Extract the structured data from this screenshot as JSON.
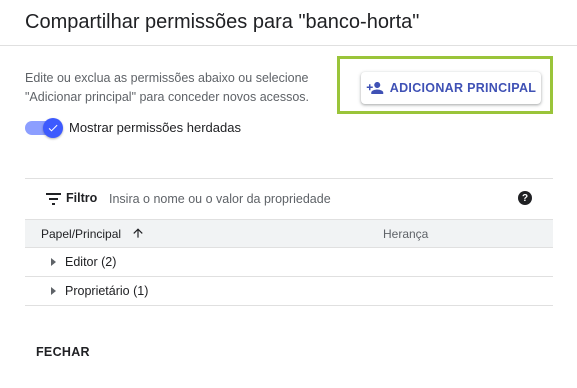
{
  "dialog": {
    "title": "Compartilhar permissões para \"banco-horta\"",
    "description": "Edite ou exclua as permissões abaixo ou selecione \"Adicionar principal\" para conceder novos acessos.",
    "add_principal_label": "ADICIONAR PRINCIPAL",
    "add_principal_icon": "person-add-icon",
    "accent_color": "#3f51b5",
    "highlight_color": "#9ac43a"
  },
  "toggle": {
    "label": "Mostrar permissões herdadas",
    "checked": true,
    "color": "#3d5afe"
  },
  "filter": {
    "label": "Filtro",
    "placeholder": "Insira o nome ou o valor da propriedade",
    "value": ""
  },
  "table": {
    "columns": [
      "Papel/Principal",
      "Herança"
    ],
    "sort_icon": "arrow-upward-icon",
    "rows": [
      {
        "label": "Editor (2)"
      },
      {
        "label": "Proprietário (1)"
      }
    ]
  },
  "footer": {
    "close_label": "FECHAR"
  }
}
